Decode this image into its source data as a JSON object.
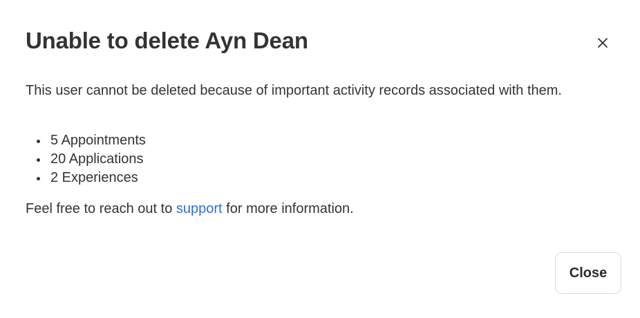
{
  "dialog": {
    "title": "Unable to delete Ayn Dean",
    "close_icon": "close-icon",
    "message": "This user cannot be deleted because of important activity records associated with them.",
    "items": [
      {
        "label": "5 Appointments"
      },
      {
        "label": "20 Applications"
      },
      {
        "label": "2 Experiences"
      }
    ],
    "footer": {
      "before": "Feel free to reach out to ",
      "link": "support",
      "after": " for more information."
    },
    "close_button_label": "Close",
    "link_color": "#2f6fd6"
  }
}
